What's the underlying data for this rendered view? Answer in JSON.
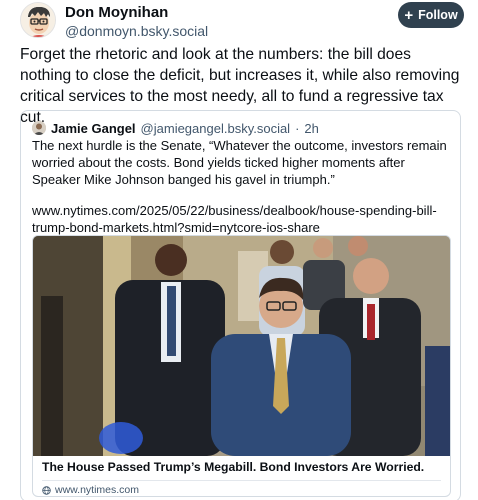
{
  "post": {
    "author_name": "Don Moynihan",
    "author_handle": "@donmoyn.bsky.social",
    "follow_label": "Follow",
    "text": "Forget the rhetoric and look at the numbers: the bill does nothing to close the deficit, but increases it, while also removing critical services to the most needy, all to fund a regressive tax cut."
  },
  "quote": {
    "author_name": "Jamie Gangel",
    "author_handle": "@jamiegangel.bsky.social",
    "separator": "·",
    "time": "2h",
    "text": "The next hurdle is the Senate, “Whatever the outcome, investors remain worried about the costs. Bond yields ticked higher moments after Speaker Mike Johnson banged his gavel in triumph.”",
    "url": "www.nytimes.com/2025/05/22/business/dealbook/house-spending-bill-trump-bond-markets.html?smid=nytcore-ios-share"
  },
  "link_card": {
    "title": "The House Passed Trump’s Megabill. Bond Investors Are Worried.",
    "domain": "www.nytimes.com"
  },
  "icons": {
    "follow": "plus-icon",
    "domain": "globe-icon"
  },
  "colors": {
    "follow_bg": "#30414f",
    "muted_text": "#42576c",
    "border": "#d4dbe2"
  }
}
